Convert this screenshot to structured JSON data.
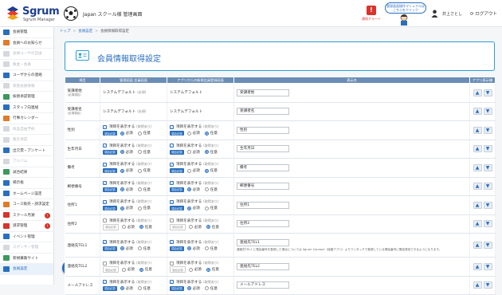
{
  "header": {
    "logo_text": "Sgrum",
    "logo_sub": "Sgrum Manager",
    "org_name": "Japan スクール様 管理画面",
    "alert_label": "通知アラート",
    "manual_text": "管理画面操作マニュアルはこちらをクリック",
    "user_name": "井上さとし",
    "logout_label": "ログアウト"
  },
  "sidebar": {
    "items": [
      {
        "label": "会員管理",
        "icon": "member-icon",
        "disabled": false
      },
      {
        "label": "会員へのお知らせ",
        "icon": "notice-icon",
        "disabled": false
      },
      {
        "label": "会員ユーザの自由",
        "icon": "user-free-icon",
        "disabled": true
      },
      {
        "label": "集金・会員",
        "icon": "collect-icon",
        "disabled": true
      },
      {
        "label": "ユーザからの連絡",
        "icon": "contact-icon",
        "disabled": false
      },
      {
        "label": "家族会員情報",
        "icon": "family-icon",
        "disabled": true
      },
      {
        "label": "振替承認管理",
        "icon": "transfer-icon",
        "disabled": false
      },
      {
        "label": "スタッフ向連絡",
        "icon": "staff-icon",
        "disabled": false
      },
      {
        "label": "行事カレンダー",
        "icon": "calendar-icon",
        "disabled": false
      },
      {
        "label": "商品自由予約",
        "icon": "goods-icon",
        "disabled": true
      },
      {
        "label": "集計承認",
        "icon": "total-icon",
        "disabled": true
      },
      {
        "label": "出欠票・アンケート",
        "icon": "survey-icon",
        "disabled": false
      },
      {
        "label": "アルバム",
        "icon": "album-icon",
        "disabled": true
      },
      {
        "label": "試合結果",
        "icon": "result-icon",
        "disabled": false
      },
      {
        "label": "掲示板",
        "icon": "board-icon",
        "disabled": false
      },
      {
        "label": "ホームページ設定",
        "icon": "homepage-icon",
        "disabled": false
      },
      {
        "label": "コース販売・請求設定",
        "icon": "course-icon",
        "disabled": false
      },
      {
        "label": "スクール月謝",
        "icon": "fee-icon",
        "disabled": false,
        "badge": "!"
      },
      {
        "label": "請求管理",
        "icon": "billing-icon",
        "disabled": false,
        "badge": "!"
      },
      {
        "label": "イベント管理",
        "icon": "event-icon",
        "disabled": false
      },
      {
        "label": "スポンサー管理",
        "icon": "sponsor-icon",
        "disabled": true
      },
      {
        "label": "新規募集サイト",
        "icon": "recruit-icon",
        "disabled": false
      },
      {
        "label": "会員設定",
        "icon": "settings-icon",
        "disabled": false,
        "active": true
      }
    ]
  },
  "breadcrumb": {
    "home": "トップ",
    "parent": "会員設定",
    "current": "会員情報取得設定"
  },
  "page": {
    "title": "会員情報取得設定"
  },
  "table": {
    "headers": [
      "項目",
      "管理画面 会員画面",
      "アプリからの新規会員登録画面",
      "表示名",
      "アプリ表示順"
    ],
    "show_label": "項目を表示する",
    "show_note": "(取得あり)",
    "required_tag": "項目必須",
    "optional_tag": "項目任意",
    "required_label": "必須",
    "optional_label": "任意",
    "system_default": "システムデフォルト",
    "required_note": "(必須)",
    "rows": [
      {
        "item": "受講者姓",
        "sub": "(必須項目)",
        "fixed": true,
        "name": "受講者姓"
      },
      {
        "item": "受講者名",
        "sub": "(必須項目)",
        "fixed": true,
        "name": "受講者名"
      },
      {
        "item": "性別",
        "name": "性別",
        "a": {
          "show": true,
          "req": true
        },
        "b": {
          "show": true,
          "req": false
        }
      },
      {
        "item": "生年月日",
        "name": "生年月日",
        "a": {
          "show": true,
          "req": true
        },
        "b": {
          "show": true,
          "req": false
        }
      },
      {
        "item": "備考",
        "name": "備考",
        "a": {
          "show": true,
          "req": true
        },
        "b": {
          "show": true,
          "req": false
        }
      },
      {
        "item": "郵便番号",
        "name": "郵便番号",
        "a": {
          "show": true,
          "req": true
        },
        "b": {
          "show": true,
          "req": true
        }
      },
      {
        "item": "住所1",
        "name": "住所1",
        "a": {
          "show": true,
          "req": true
        },
        "b": {
          "show": true,
          "req": true
        }
      },
      {
        "item": "住所2",
        "name": "住所2",
        "a": {
          "show": false,
          "req": false
        },
        "b": {
          "show": false,
          "req": false
        }
      },
      {
        "item": "連絡先TEL1",
        "name": "連絡先TEL1",
        "a": {
          "show": true,
          "req": true
        },
        "b": {
          "show": true,
          "req": true
        },
        "hint": "連絡先TEL1 に電話番号を登録した場合については Sgrum Connect（保護アプリ）よりワンタッチで登録している電話番号に電話発信できるようになります。"
      },
      {
        "item": "連絡先TEL2",
        "name": "連絡先TEL2",
        "a": {
          "show": false,
          "req": false
        },
        "b": {
          "show": false,
          "req": false
        }
      },
      {
        "item": "メールアドレス",
        "name": "メールアドレス",
        "a": {
          "show": true,
          "req": true
        },
        "b": {
          "show": true,
          "req": true
        }
      }
    ]
  },
  "colors": {
    "brand": "#1d3f8f",
    "accent": "#2a6fbf",
    "panel_border": "#2a9fd6",
    "header_row": "#6b8db5",
    "alert": "#d9342b"
  }
}
